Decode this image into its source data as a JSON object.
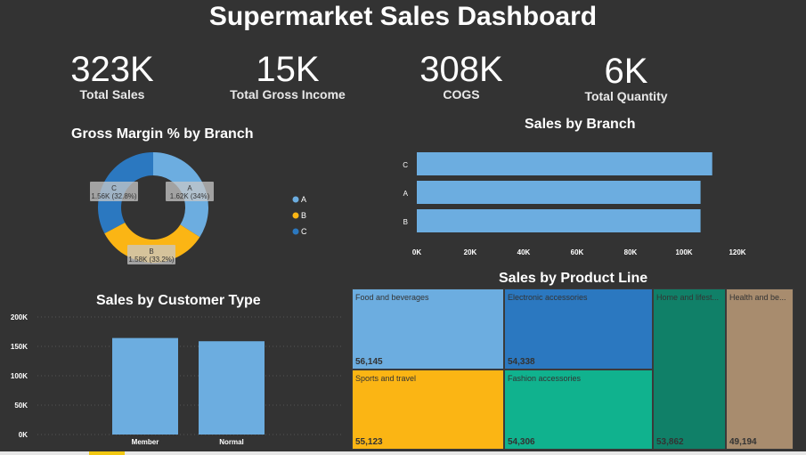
{
  "title": "Supermarket Sales Dashboard",
  "kpis": [
    {
      "value": "323K",
      "label": "Total Sales"
    },
    {
      "value": "15K",
      "label": "Total Gross Income"
    },
    {
      "value": "308K",
      "label": "COGS"
    },
    {
      "value": "6K",
      "label": "Total Quantity"
    }
  ],
  "colors": {
    "background": "#333333",
    "a": "#6cade0",
    "b": "#fbb514",
    "c": "#2b78c0",
    "electronic": "#2b78c0",
    "fashion": "#10b28e",
    "home": "#108068",
    "health": "#a88c6e"
  },
  "chart_data": [
    {
      "type": "pie",
      "title": "Gross Margin % by Branch",
      "categories": [
        "A",
        "B",
        "C"
      ],
      "values": [
        34,
        33.2,
        32.8
      ],
      "data_labels": [
        "1.62K (34%)",
        "1.58K (33.2%)",
        "1.56K (32.8%)"
      ],
      "donut": true,
      "legend": "right"
    },
    {
      "type": "bar",
      "orientation": "horizontal",
      "title": "Sales by Branch",
      "categories": [
        "C",
        "A",
        "B"
      ],
      "values": [
        110569,
        106200,
        106198
      ],
      "xlim": [
        0,
        120000
      ],
      "ticks": [
        "0K",
        "20K",
        "40K",
        "60K",
        "80K",
        "100K",
        "120K"
      ]
    },
    {
      "type": "bar",
      "title": "Sales by Customer Type",
      "categories": [
        "Member",
        "Normal"
      ],
      "values": [
        164223,
        158743
      ],
      "ylim": [
        0,
        200000
      ],
      "ticks": [
        "0K",
        "50K",
        "100K",
        "150K",
        "200K"
      ],
      "grid": true
    },
    {
      "type": "treemap",
      "title": "Sales by Product Line",
      "items": [
        {
          "name": "Food and beverages",
          "label": "Food and beverages",
          "value": 56145,
          "value_label": "56,145"
        },
        {
          "name": "Sports and travel",
          "label": "Sports and travel",
          "value": 55123,
          "value_label": "55,123"
        },
        {
          "name": "Electronic accessories",
          "label": "Electronic accessories",
          "value": 54338,
          "value_label": "54,338"
        },
        {
          "name": "Fashion accessories",
          "label": "Fashion accessories",
          "value": 54306,
          "value_label": "54,306"
        },
        {
          "name": "Home and lifestyle",
          "label": "Home and lifest...",
          "value": 53862,
          "value_label": "53,862"
        },
        {
          "name": "Health and beauty",
          "label": "Health and be...",
          "value": 49194,
          "value_label": "49,194"
        }
      ]
    }
  ]
}
